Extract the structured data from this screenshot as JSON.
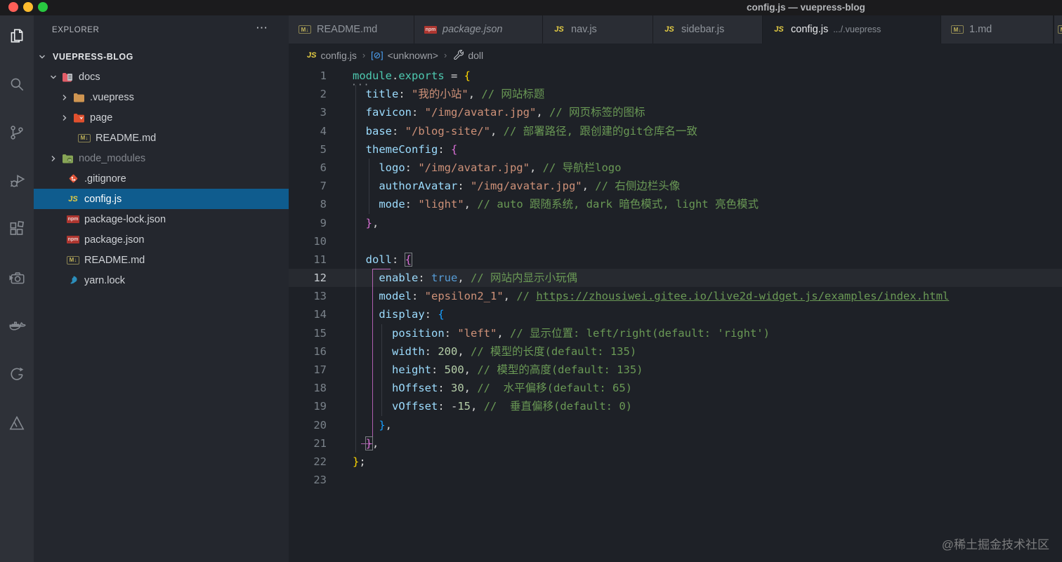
{
  "window": {
    "title": "config.js — vuepress-blog"
  },
  "activity_bar": {
    "items": [
      {
        "name": "explorer",
        "icon": "files-icon",
        "active": true
      },
      {
        "name": "search",
        "icon": "search-icon"
      },
      {
        "name": "source-control",
        "icon": "source-control-icon"
      },
      {
        "name": "run-debug",
        "icon": "debug-icon"
      },
      {
        "name": "extensions",
        "icon": "extensions-icon"
      },
      {
        "name": "codesnap",
        "icon": "camera-icon"
      },
      {
        "name": "docker",
        "icon": "docker-icon"
      },
      {
        "name": "gitlens",
        "icon": "gitlens-icon"
      },
      {
        "name": "tour",
        "icon": "mountain-icon"
      }
    ]
  },
  "sidebar": {
    "header": "EXPLORER",
    "more_icon": "⋯",
    "root": {
      "label": "VUEPRESS-BLOG",
      "expanded": true
    },
    "items": [
      {
        "label": "docs",
        "icon": "docs-folder-icon",
        "expanded": true
      },
      {
        "label": ".vuepress",
        "icon": "folder-icon"
      },
      {
        "label": "page",
        "icon": "page-folder-icon"
      },
      {
        "label": "README.md",
        "icon": "markdown-icon"
      },
      {
        "label": "node_modules",
        "icon": "node-modules-folder-icon",
        "dim": true
      },
      {
        "label": ".gitignore",
        "icon": "git-icon"
      },
      {
        "label": "config.js",
        "icon": "js-icon",
        "selected": true
      },
      {
        "label": "package-lock.json",
        "icon": "npm-icon"
      },
      {
        "label": "package.json",
        "icon": "npm-icon"
      },
      {
        "label": "README.md",
        "icon": "markdown-icon"
      },
      {
        "label": "yarn.lock",
        "icon": "yarn-icon"
      }
    ]
  },
  "tabs": [
    {
      "label": "README.md",
      "icon": "markdown-icon"
    },
    {
      "label": "package.json",
      "icon": "npm-icon",
      "italic": true
    },
    {
      "label": "nav.js",
      "icon": "js-icon"
    },
    {
      "label": "sidebar.js",
      "icon": "js-icon"
    },
    {
      "label": "config.js",
      "detail": ".../.vuepress",
      "icon": "js-icon",
      "active": true
    },
    {
      "label": "1.md",
      "icon": "markdown-icon"
    }
  ],
  "breadcrumb": {
    "items": [
      {
        "label": "config.js",
        "icon": "js-icon"
      },
      {
        "label": "<unknown>",
        "icon": "symbol-icon"
      },
      {
        "label": "doll",
        "icon": "wrench-icon"
      }
    ]
  },
  "editor": {
    "lines": [
      {
        "num": 1,
        "segments": [
          {
            "t": "module",
            "c": "t"
          },
          {
            "t": ".",
            "c": "p"
          },
          {
            "t": "exports",
            "c": "t"
          },
          {
            "t": " = ",
            "c": "p"
          },
          {
            "t": "{",
            "c": "b1"
          }
        ]
      },
      {
        "num": 2,
        "segments": [
          {
            "t": "  ",
            "c": "p"
          },
          {
            "t": "title",
            "c": "k"
          },
          {
            "t": ": ",
            "c": "p"
          },
          {
            "t": "\"我的小站\"",
            "c": "s"
          },
          {
            "t": ", ",
            "c": "p"
          },
          {
            "t": "// 网站标题",
            "c": "c"
          }
        ]
      },
      {
        "num": 3,
        "segments": [
          {
            "t": "  ",
            "c": "p"
          },
          {
            "t": "favicon",
            "c": "k"
          },
          {
            "t": ": ",
            "c": "p"
          },
          {
            "t": "\"/img/avatar.jpg\"",
            "c": "s"
          },
          {
            "t": ", ",
            "c": "p"
          },
          {
            "t": "// 网页标签的图标",
            "c": "c"
          }
        ]
      },
      {
        "num": 4,
        "segments": [
          {
            "t": "  ",
            "c": "p"
          },
          {
            "t": "base",
            "c": "k"
          },
          {
            "t": ": ",
            "c": "p"
          },
          {
            "t": "\"/blog-site/\"",
            "c": "s"
          },
          {
            "t": ", ",
            "c": "p"
          },
          {
            "t": "// 部署路径, 跟创建的git仓库名一致",
            "c": "c"
          }
        ]
      },
      {
        "num": 5,
        "segments": [
          {
            "t": "  ",
            "c": "p"
          },
          {
            "t": "themeConfig",
            "c": "k"
          },
          {
            "t": ": ",
            "c": "p"
          },
          {
            "t": "{",
            "c": "b2"
          }
        ]
      },
      {
        "num": 6,
        "segments": [
          {
            "t": "    ",
            "c": "p"
          },
          {
            "t": "logo",
            "c": "k"
          },
          {
            "t": ": ",
            "c": "p"
          },
          {
            "t": "\"/img/avatar.jpg\"",
            "c": "s"
          },
          {
            "t": ", ",
            "c": "p"
          },
          {
            "t": "// 导航栏logo",
            "c": "c"
          }
        ]
      },
      {
        "num": 7,
        "segments": [
          {
            "t": "    ",
            "c": "p"
          },
          {
            "t": "authorAvatar",
            "c": "k"
          },
          {
            "t": ": ",
            "c": "p"
          },
          {
            "t": "\"/img/avatar.jpg\"",
            "c": "s"
          },
          {
            "t": ", ",
            "c": "p"
          },
          {
            "t": "// 右侧边栏头像",
            "c": "c"
          }
        ]
      },
      {
        "num": 8,
        "segments": [
          {
            "t": "    ",
            "c": "p"
          },
          {
            "t": "mode",
            "c": "k"
          },
          {
            "t": ": ",
            "c": "p"
          },
          {
            "t": "\"light\"",
            "c": "s"
          },
          {
            "t": ", ",
            "c": "p"
          },
          {
            "t": "// auto 跟随系统, dark 暗色模式, light 亮色模式",
            "c": "c"
          }
        ]
      },
      {
        "num": 9,
        "segments": [
          {
            "t": "  ",
            "c": "p"
          },
          {
            "t": "}",
            "c": "b2"
          },
          {
            "t": ",",
            "c": "p"
          }
        ]
      },
      {
        "num": 10,
        "segments": []
      },
      {
        "num": 11,
        "segments": [
          {
            "t": "  ",
            "c": "p"
          },
          {
            "t": "doll",
            "c": "k"
          },
          {
            "t": ": ",
            "c": "p"
          },
          {
            "t": "{",
            "c": "b2",
            "box": true
          }
        ]
      },
      {
        "num": 12,
        "current": true,
        "segments": [
          {
            "t": "    ",
            "c": "p"
          },
          {
            "t": "enable",
            "c": "k"
          },
          {
            "t": ": ",
            "c": "p"
          },
          {
            "t": "true",
            "c": "kw"
          },
          {
            "t": ", ",
            "c": "p"
          },
          {
            "t": "// 网站内显示小玩偶",
            "c": "c"
          }
        ]
      },
      {
        "num": 13,
        "segments": [
          {
            "t": "    ",
            "c": "p"
          },
          {
            "t": "model",
            "c": "k"
          },
          {
            "t": ": ",
            "c": "p"
          },
          {
            "t": "\"epsilon2_1\"",
            "c": "s"
          },
          {
            "t": ", ",
            "c": "p"
          },
          {
            "t": "// ",
            "c": "c"
          },
          {
            "t": "https://zhousiwei.gitee.io/live2d-widget.js/examples/index.html",
            "c": "c",
            "u": true
          }
        ]
      },
      {
        "num": 14,
        "segments": [
          {
            "t": "    ",
            "c": "p"
          },
          {
            "t": "display",
            "c": "k"
          },
          {
            "t": ": ",
            "c": "p"
          },
          {
            "t": "{",
            "c": "b3"
          }
        ]
      },
      {
        "num": 15,
        "segments": [
          {
            "t": "      ",
            "c": "p"
          },
          {
            "t": "position",
            "c": "k"
          },
          {
            "t": ": ",
            "c": "p"
          },
          {
            "t": "\"left\"",
            "c": "s"
          },
          {
            "t": ", ",
            "c": "p"
          },
          {
            "t": "// 显示位置: left/right(default: 'right')",
            "c": "c"
          }
        ]
      },
      {
        "num": 16,
        "segments": [
          {
            "t": "      ",
            "c": "p"
          },
          {
            "t": "width",
            "c": "k"
          },
          {
            "t": ": ",
            "c": "p"
          },
          {
            "t": "200",
            "c": "n"
          },
          {
            "t": ", ",
            "c": "p"
          },
          {
            "t": "// 模型的长度(default: 135)",
            "c": "c"
          }
        ]
      },
      {
        "num": 17,
        "segments": [
          {
            "t": "      ",
            "c": "p"
          },
          {
            "t": "height",
            "c": "k"
          },
          {
            "t": ": ",
            "c": "p"
          },
          {
            "t": "500",
            "c": "n"
          },
          {
            "t": ", ",
            "c": "p"
          },
          {
            "t": "// 模型的高度(default: 135)",
            "c": "c"
          }
        ]
      },
      {
        "num": 18,
        "segments": [
          {
            "t": "      ",
            "c": "p"
          },
          {
            "t": "hOffset",
            "c": "k"
          },
          {
            "t": ": ",
            "c": "p"
          },
          {
            "t": "30",
            "c": "n"
          },
          {
            "t": ", ",
            "c": "p"
          },
          {
            "t": "//  水平偏移(default: 65)",
            "c": "c"
          }
        ]
      },
      {
        "num": 19,
        "segments": [
          {
            "t": "      ",
            "c": "p"
          },
          {
            "t": "vOffset",
            "c": "k"
          },
          {
            "t": ": ",
            "c": "p"
          },
          {
            "t": "-",
            "c": "p"
          },
          {
            "t": "15",
            "c": "n"
          },
          {
            "t": ", ",
            "c": "p"
          },
          {
            "t": "//  垂直偏移(default: 0)",
            "c": "c"
          }
        ]
      },
      {
        "num": 20,
        "segments": [
          {
            "t": "    ",
            "c": "p"
          },
          {
            "t": "}",
            "c": "b3"
          },
          {
            "t": ",",
            "c": "p"
          }
        ]
      },
      {
        "num": 21,
        "segments": [
          {
            "t": "  ",
            "c": "p"
          },
          {
            "t": "}",
            "c": "b2",
            "box": true
          },
          {
            "t": ",",
            "c": "p"
          }
        ]
      },
      {
        "num": 22,
        "segments": [
          {
            "t": "}",
            "c": "b1"
          },
          {
            "t": ";",
            "c": "p"
          }
        ]
      },
      {
        "num": 23,
        "segments": []
      }
    ]
  },
  "watermark": "@稀土掘金技术社区",
  "colors": {
    "selection_blue": "#0f5c8e",
    "editor_bg": "#1e2127",
    "sidebar_bg": "#24272e",
    "activitybar_bg": "#2e3138",
    "bracket_gold": "#ffd700",
    "bracket_orchid": "#da70d6",
    "bracket_blue": "#179fff",
    "string": "#ce9178",
    "comment": "#6a9955",
    "key": "#9cdcfe"
  }
}
